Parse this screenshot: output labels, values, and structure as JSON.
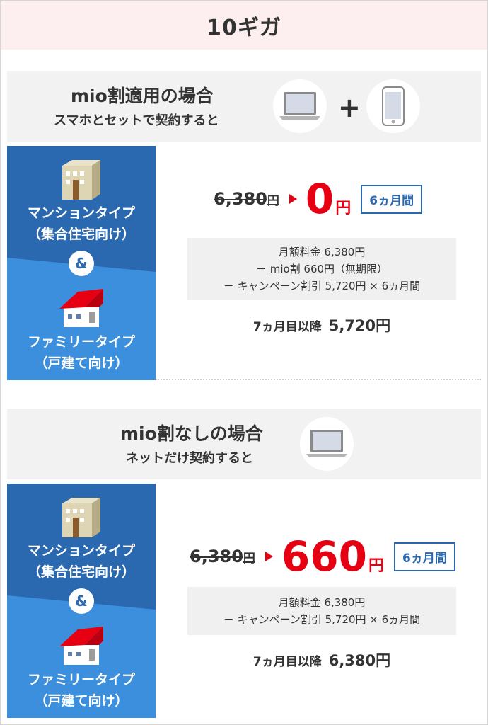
{
  "title": "10ギガ",
  "plans": [
    {
      "heading": "mio割適用の場合",
      "subheading": "スマホとセットで契約すると",
      "devices": [
        "laptop-icon",
        "smartphone-icon"
      ],
      "plus": "+",
      "types": {
        "mansion_label_1": "マンションタイプ",
        "mansion_label_2": "（集合住宅向け）",
        "amp": "&",
        "family_label_1": "ファミリータイプ",
        "family_label_2": "（戸建て向け）"
      },
      "old_price": "6,380",
      "old_price_unit": "円",
      "new_price": "0",
      "new_price_unit": "円",
      "duration_badge": "6ヵ月間",
      "breakdown": [
        "月額料金 6,380円",
        "－ mio割 660円（無期限）",
        "－ キャンペーン割引 5,720円 × 6ヵ月間"
      ],
      "after_label": "7ヵ月目以降",
      "after_price": "5,720円"
    },
    {
      "heading": "mio割なしの場合",
      "subheading": "ネットだけ契約すると",
      "devices": [
        "laptop-icon"
      ],
      "types": {
        "mansion_label_1": "マンションタイプ",
        "mansion_label_2": "（集合住宅向け）",
        "amp": "&",
        "family_label_1": "ファミリータイプ",
        "family_label_2": "（戸建て向け）"
      },
      "old_price": "6,380",
      "old_price_unit": "円",
      "new_price": "660",
      "new_price_unit": "円",
      "duration_badge": "6ヵ月間",
      "breakdown": [
        "月額料金 6,380円",
        "－ キャンペーン割引 5,720円 × 6ヵ月間"
      ],
      "after_label": "7ヵ月目以降",
      "after_price": "6,380円"
    }
  ],
  "colors": {
    "title_bg": "#fdeff0",
    "panel_dark": "#2a68b0",
    "panel_light": "#3b8fdc",
    "red": "#e60012",
    "gray_bg": "#f2f2f2"
  }
}
